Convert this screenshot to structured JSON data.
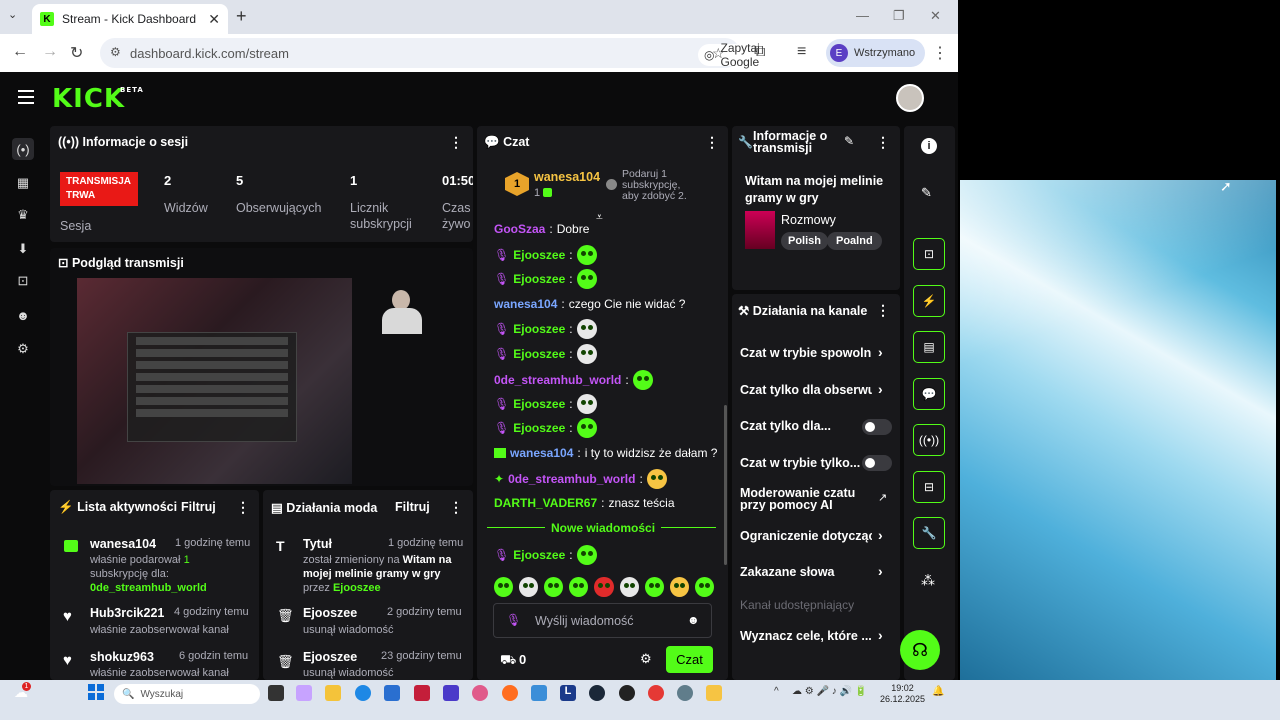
{
  "browser": {
    "tab_title": "Stream - Kick Dashboard",
    "url": "dashboard.kick.com/stream",
    "google_chip": "Zapytaj Google",
    "profile_initial": "E",
    "profile_status": "Wstrzymano"
  },
  "brand": {
    "logo": "KICK",
    "badge": "BETA",
    "accent": "#53fc18"
  },
  "session": {
    "title": "Informacje o sesji",
    "live_badge": "TRANSMISJA TRWA",
    "live_sub": "Sesja",
    "stats": [
      {
        "value": "2",
        "label": "Widzów"
      },
      {
        "value": "5",
        "label": "Obserwujących"
      },
      {
        "value": "1",
        "label": "Licznik subskrypcji"
      },
      {
        "value": "01:50",
        "label": "Czas żywo"
      }
    ]
  },
  "preview": {
    "title": "Podgląd transmisji"
  },
  "activity": {
    "title": "Lista aktywności",
    "filter": "Filtruj",
    "items": [
      {
        "name": "wanesa104",
        "time": "1 godzinę temu",
        "text": "właśnie podarował",
        "highlight": "1",
        "text2": "subskrypcję dla:",
        "target": "0de_streamhub_world"
      },
      {
        "name": "Hub3rcik221",
        "time": "4 godziny temu",
        "text": "właśnie zaobserwował kanał"
      },
      {
        "name": "shokuz963",
        "time": "6 godzin temu",
        "text": "właśnie zaobserwował kanał"
      }
    ]
  },
  "modactions": {
    "title": "Działania moda",
    "filter": "Filtruj",
    "items": [
      {
        "name": "Tytuł",
        "time": "1 godzinę temu",
        "pre": "został zmieniony na",
        "bold": "Witam na mojej melinie gramy w gry",
        "mid": "przez",
        "by": "Ejooszee"
      },
      {
        "name": "Ejooszee",
        "time": "2 godziny temu",
        "text": "usunął wiadomość"
      },
      {
        "name": "Ejooszee",
        "time": "23 godziny temu",
        "text": "usunął wiadomość"
      }
    ]
  },
  "chat": {
    "title": "Czat",
    "top_user": "wanesa104",
    "top_rank": "1",
    "top_count": "1",
    "gift_text": "Podaruj 1 subskrypcję, aby zdobyć 2.",
    "cut_line_user": "GooSzaa",
    "cut_line_msg": "Dobre",
    "messages": [
      {
        "user": "Ejooszee",
        "msg": "",
        "emote": true
      },
      {
        "user": "Ejooszee",
        "msg": "",
        "emote": true
      },
      {
        "user": "wanesa104",
        "msg": "czego Cie nie widać ?"
      },
      {
        "user": "Ejooszee",
        "msg": "",
        "emote": true
      },
      {
        "user": "Ejooszee",
        "msg": "",
        "emote": true
      },
      {
        "user": "0de_streamhub_world",
        "msg": "",
        "emote": true
      },
      {
        "user": "Ejooszee",
        "msg": "",
        "emote": true
      },
      {
        "user": "Ejooszee",
        "msg": "",
        "emote": true
      },
      {
        "user": "wanesa104",
        "msg": "i ty to widzisz że dałam ?"
      },
      {
        "user": "0de_streamhub_world",
        "msg": "",
        "emote": true
      },
      {
        "user": "DARTH_VADER67",
        "msg": "znasz teścia"
      }
    ],
    "new_messages": "Nowe wiadomości",
    "last_user": "Ejooszee",
    "input_placeholder": "Wyślij wiadomość",
    "viewer_count": "0",
    "send_label": "Czat"
  },
  "stream_info": {
    "title": "Informacje o transmisji",
    "stream_title": "Witam na mojej melinie gramy w gry",
    "category": "Rozmowy",
    "tags": [
      "Polish",
      "Poalnd"
    ]
  },
  "channel_actions": {
    "title": "Działania na kanale",
    "rows": [
      "Czat w trybie spowolnionym",
      "Czat tylko dla obserwujących",
      "Czat tylko dla...",
      "Czat w trybie tylko...",
      "Moderowanie czatu przy pomocy AI",
      "Ograniczenie dotyczące",
      "Zakazane słowa",
      "Kanał udostępniający",
      "Wyznacz cele, które ..."
    ]
  },
  "taskbar": {
    "search": "Wyszukaj",
    "time": "19:02",
    "date": "26.12.2025",
    "notif": "1"
  }
}
